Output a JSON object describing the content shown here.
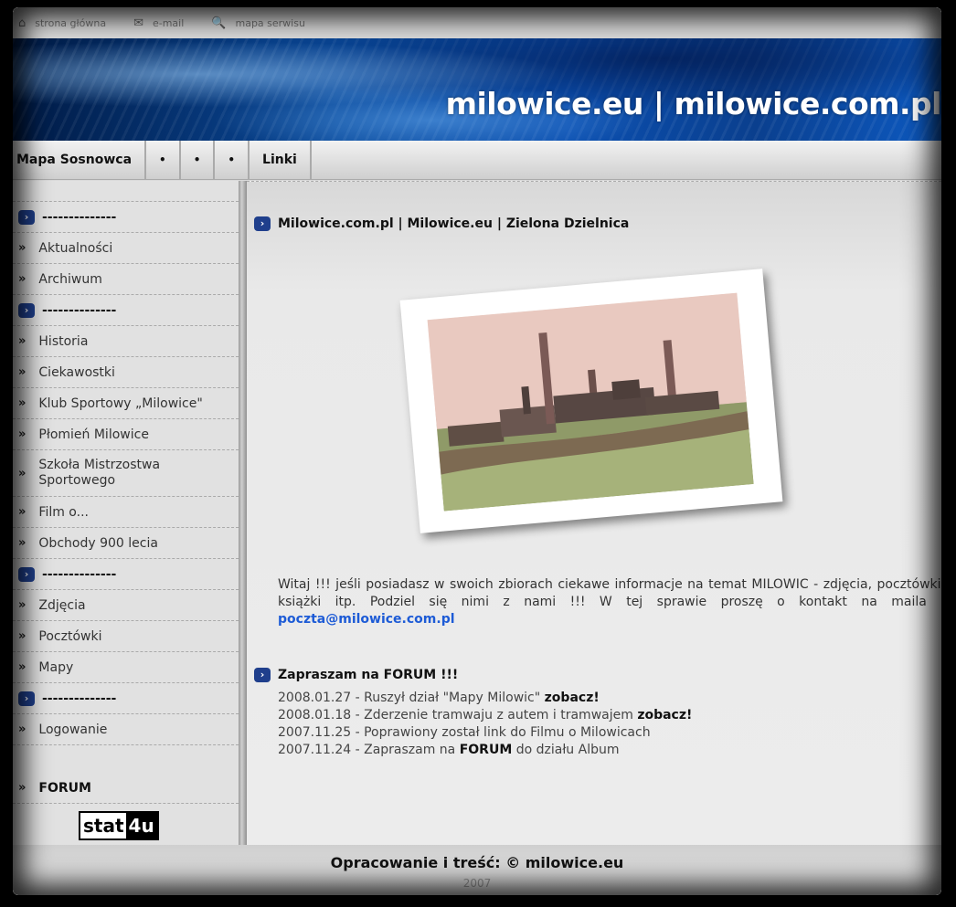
{
  "topnav": [
    {
      "icon": "home-icon",
      "glyph": "⌂",
      "label": "strona główna"
    },
    {
      "icon": "mail-icon",
      "glyph": "✉",
      "label": "e-mail"
    },
    {
      "icon": "search-icon",
      "glyph": "🔍",
      "label": "mapa serwisu"
    }
  ],
  "banner": {
    "title": "milowice.eu | milowice.com.pl"
  },
  "menu": {
    "items": [
      "Mapa Sosnowca",
      "•",
      "•",
      "•",
      "Linki"
    ]
  },
  "sidebar": {
    "items": [
      {
        "label": "--------------",
        "head": true
      },
      {
        "label": "Aktualności"
      },
      {
        "label": "Archiwum"
      },
      {
        "label": "--------------",
        "head": true
      },
      {
        "label": "Historia"
      },
      {
        "label": "Ciekawostki"
      },
      {
        "label": "Klub Sportowy „Milowice\""
      },
      {
        "label": "Płomień Milowice"
      },
      {
        "label": "Szkoła Mistrzostwa Sportowego",
        "double": true
      },
      {
        "label": "Film o..."
      },
      {
        "label": "Obchody 900 lecia"
      },
      {
        "label": "--------------",
        "head": true
      },
      {
        "label": "Zdjęcia"
      },
      {
        "label": "Pocztówki"
      },
      {
        "label": "Mapy"
      },
      {
        "label": "--------------",
        "head": true
      },
      {
        "label": "Logowanie"
      }
    ],
    "forum_label": "FORUM",
    "stat_a": "stat",
    "stat_b": "4u"
  },
  "main": {
    "heading": "Milowice.com.pl | Milowice.eu | Zielona Dzielnica",
    "intro_text": "Witaj !!! jeśli posiadasz w swoich zbiorach ciekawe informacje na temat MILOWIC - zdjęcia, pocztówki, książki itp. Podziel się nimi z nami !!! W tej sprawie proszę o kontakt na maila : ",
    "email": "poczta@milowice.com.pl",
    "forum_heading": "Zapraszam na FORUM !!!",
    "news": [
      {
        "text": "2008.01.27 - Ruszył dział \"Mapy Milowic\" ",
        "bold": "zobacz!",
        "after": ""
      },
      {
        "text": "2008.01.18 - Zderzenie tramwaju z autem i tramwajem ",
        "bold": "zobacz!",
        "after": ""
      },
      {
        "text": "2007.11.25 - Poprawiony został link do Filmu o Milowicach",
        "bold": "",
        "after": ""
      },
      {
        "text": "2007.11.24 - Zapraszam na ",
        "bold": "FORUM",
        "after": " do działu Album"
      }
    ]
  },
  "footer": {
    "text": "Opracowanie i treść: © milowice.eu",
    "year": "2007"
  }
}
